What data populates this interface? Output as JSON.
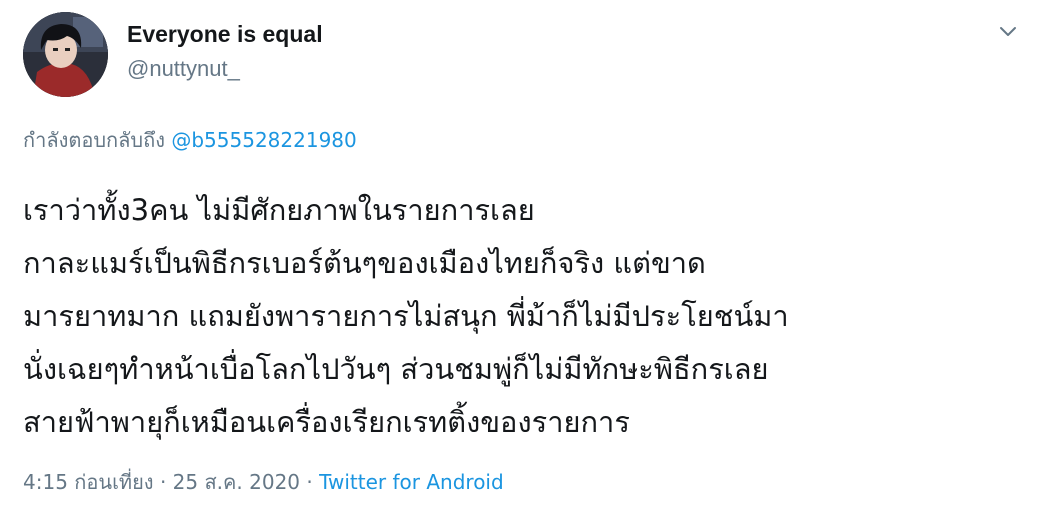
{
  "author": {
    "display_name": "Everyone is equal",
    "handle": "@nuttynut_",
    "avatar": "profile-avatar-anime-character"
  },
  "menu_icon": "chevron-down-icon",
  "reply": {
    "prefix": "กำลังตอบกลับถึง",
    "mention": "@b555528221980"
  },
  "tweet": {
    "lines": [
      "เราว่าทั้ง3คน ไม่มีศักยภาพในรายการเลย",
      "กาละแมร์เป็นพิธีกรเบอร์ต้นๆของเมืองไทยก็จริง แต่ขาด",
      "มารยาทมาก แถมยังพารายการไม่สนุก พี่ม้าก็ไม่มีประโยชน์มา",
      "นั่งเฉยๆทำหน้าเบื่อโลกไปวันๆ ส่วนชมพู่ก็ไม่มีทักษะพิธีกรเลย",
      "สายฟ้าพายุก็เหมือนเครื่องเรียกเรทติ้งของรายการ"
    ]
  },
  "meta": {
    "time": "4:15 ก่อนเที่ยง",
    "separator1": "·",
    "date": "25 ส.ค. 2020",
    "separator2": "·",
    "source": "Twitter for Android"
  },
  "colors": {
    "text": "#14171a",
    "secondary": "#657786",
    "link": "#1b95e0"
  }
}
